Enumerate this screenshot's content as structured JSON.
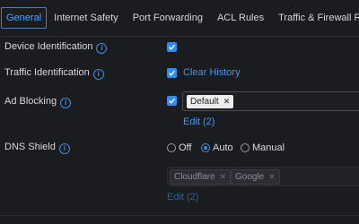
{
  "tabs": [
    {
      "label": "General",
      "active": true
    },
    {
      "label": "Internet Safety"
    },
    {
      "label": "Port Forwarding"
    },
    {
      "label": "ACL Rules"
    },
    {
      "label": "Traffic & Firewall Rules"
    }
  ],
  "settings": {
    "device_identification": {
      "label": "Device Identification",
      "checked": true
    },
    "traffic_identification": {
      "label": "Traffic Identification",
      "checked": true,
      "action": "Clear History"
    },
    "ad_blocking": {
      "label": "Ad Blocking",
      "checked": true,
      "tags": [
        "Default"
      ],
      "edit": "Edit (2)"
    },
    "dns_shield": {
      "label": "DNS Shield",
      "options": [
        "Off",
        "Auto",
        "Manual"
      ],
      "selected": "Auto",
      "servers": [
        "Cloudflare",
        "Google"
      ],
      "edit": "Edit (2)"
    }
  },
  "colors": {
    "accent": "#2f8cf0",
    "background": "#1b1c20"
  },
  "icons": {
    "info": "info-icon",
    "check": "checkmark-icon",
    "remove": "close-icon"
  }
}
